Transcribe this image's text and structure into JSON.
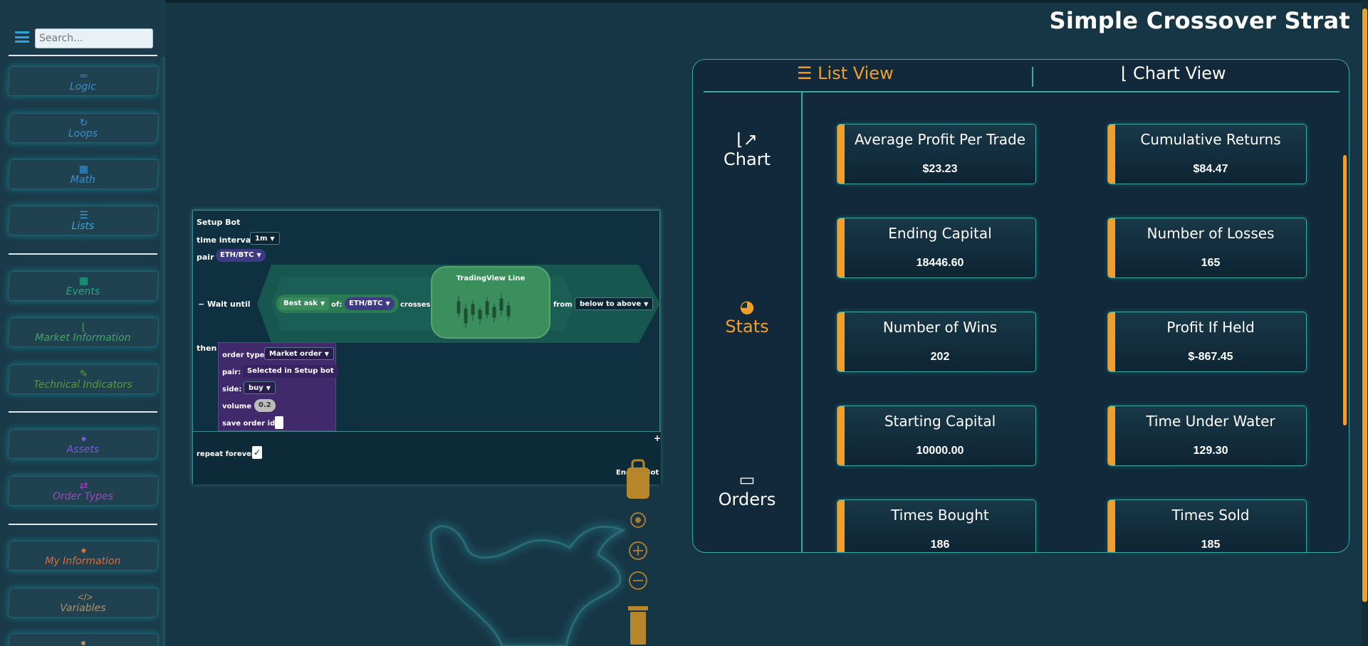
{
  "page_title": "Simple Crossover Strat",
  "sidebar": {
    "search_placeholder": "Search...",
    "categories": [
      {
        "label": "Logic",
        "icon": "equals-icon",
        "color": "#3a8fd0"
      },
      {
        "label": "Loops",
        "icon": "refresh-icon",
        "color": "#3a8fd0"
      },
      {
        "label": "Math",
        "icon": "calculator-icon",
        "color": "#3a8fd0"
      },
      {
        "label": "Lists",
        "icon": "list-icon",
        "color": "#3aa6d8"
      },
      {
        "label": "Events",
        "icon": "calendar-icon",
        "color": "#2aa38a"
      },
      {
        "label": "Market Information",
        "icon": "chart-line-icon",
        "color": "#4aa368"
      },
      {
        "label": "Technical Indicators",
        "icon": "wrench-icon",
        "color": "#5a9a3c"
      },
      {
        "label": "Assets",
        "icon": "bitcoin-icon",
        "color": "#7a5ad0"
      },
      {
        "label": "Order Types",
        "icon": "exchange-icon",
        "color": "#9a4ab8"
      },
      {
        "label": "My Information",
        "icon": "user-icon",
        "color": "#e06a3a"
      },
      {
        "label": "Variables",
        "icon": "code-icon",
        "color": "#b0906a"
      }
    ]
  },
  "blocks": {
    "setup_label": "Setup Bot",
    "time_interval_label": "time interval",
    "time_interval_value": "1m",
    "pair_label": "pair",
    "pair_value": "ETH/BTC",
    "wait_until_label": "Wait until",
    "best_ask_value": "Best ask",
    "of_label": "of:",
    "of_value": "ETH/BTC",
    "crosses_label": "crosses",
    "tradingview_label": "TradingView Line",
    "from_label": "from",
    "from_value": "below to above",
    "then_label": "then",
    "order_type_label": "order type:",
    "order_type_value": "Market order",
    "order_pair_label": "pair:",
    "order_pair_value": "Selected in Setup bot",
    "side_label": "side:",
    "side_value": "buy",
    "volume_label": "volume",
    "volume_value": "0.2",
    "save_order_id_label": "save order id:",
    "plus_label": "+",
    "repeat_forever_label": "repeat forever",
    "repeat_forever_checked": "✓",
    "end_of_bot_label": "End Of Bot",
    "minus_label": "−"
  },
  "panel": {
    "tabs": [
      {
        "label": "List View",
        "icon": "list-icon",
        "active": true
      },
      {
        "label": "Chart View",
        "icon": "chart-line-icon",
        "active": false
      }
    ],
    "side_nav": [
      {
        "label": "Chart",
        "icon": "chart-line-icon",
        "active": false
      },
      {
        "label": "Stats",
        "icon": "pie-chart-icon",
        "active": true
      },
      {
        "label": "Orders",
        "icon": "id-card-icon",
        "active": false
      }
    ],
    "stats": [
      {
        "name": "Average Profit Per Trade",
        "value": "$23.23"
      },
      {
        "name": "Cumulative Returns",
        "value": "$84.47"
      },
      {
        "name": "Ending Capital",
        "value": "18446.60"
      },
      {
        "name": "Number of Losses",
        "value": "165"
      },
      {
        "name": "Number of Wins",
        "value": "202"
      },
      {
        "name": "Profit If Held",
        "value": "$-867.45"
      },
      {
        "name": "Starting Capital",
        "value": "10000.00"
      },
      {
        "name": "Time Under Water",
        "value": "129.30"
      },
      {
        "name": "Times Bought",
        "value": "186"
      },
      {
        "name": "Times Sold",
        "value": "185"
      }
    ]
  },
  "colors": {
    "accent": "#f0a02a",
    "teal_border": "#3aa9a4",
    "background": "#173645"
  }
}
